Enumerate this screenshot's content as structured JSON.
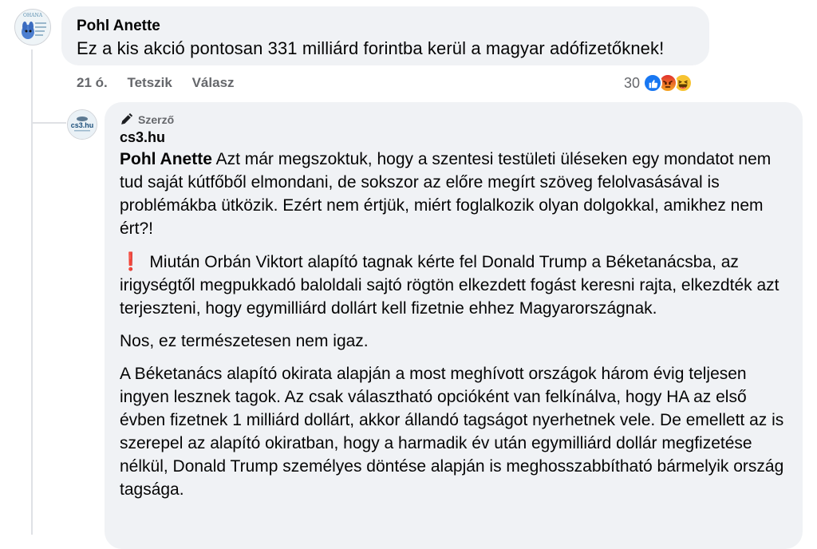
{
  "comment": {
    "author": "Pohl Anette",
    "avatar_label": "OHANA",
    "text": "Ez a kis akció pontosan 331 milliárd forintba kerül a magyar adófizetőknek!",
    "time": "21 ó.",
    "like_label": "Tetszik",
    "reply_label": "Válasz",
    "reaction_count": "30",
    "reactions": [
      "like-icon",
      "angry-icon",
      "haha-icon"
    ]
  },
  "reply": {
    "badge_label": "Szerző",
    "author": "cs3.hu",
    "avatar_label": "cs3.hu",
    "mention": "Pohl Anette",
    "para1_rest": " Azt már megszoktuk, hogy a szentesi testületi üléseken egy mondatot nem tud saját kútfőből elmondani, de sokszor az előre megírt szöveg felolvasásával is problémákba ütközik. Ezért nem értjük, miért foglalkozik olyan dolgokkal, amikhez nem ért?!",
    "exclamation": "❗",
    "para2": "Miután Orbán Viktort alapító tagnak kérte fel Donald Trump a Béketanácsba, az irigységtől megpukkadó baloldali sajtó rögtön elkezdett fogást keresni rajta, elkezdték azt terjeszteni, hogy egymilliárd dollárt kell fizetnie ehhez Magyarországnak.",
    "para3": "Nos, ez természetesen nem igaz.",
    "para4": "A Béketanács alapító okirata alapján a most meghívott országok három évig teljesen ingyen lesznek tagok. Az csak választható opcióként van felkínálva, hogy HA az első évben fizetnek 1 milliárd dollárt, akkor állandó tagságot nyerhetnek vele. De emellett az is szerepel az alapító okiratban, hogy a harmadik év után egymilliárd dollár megfizetése nélkül, Donald Trump személyes döntése alapján is meghosszabbítható bármelyik ország tagsága."
  },
  "colors": {
    "like": "#1877f2",
    "angry": "#e9710f",
    "haha": "#f7b125"
  }
}
